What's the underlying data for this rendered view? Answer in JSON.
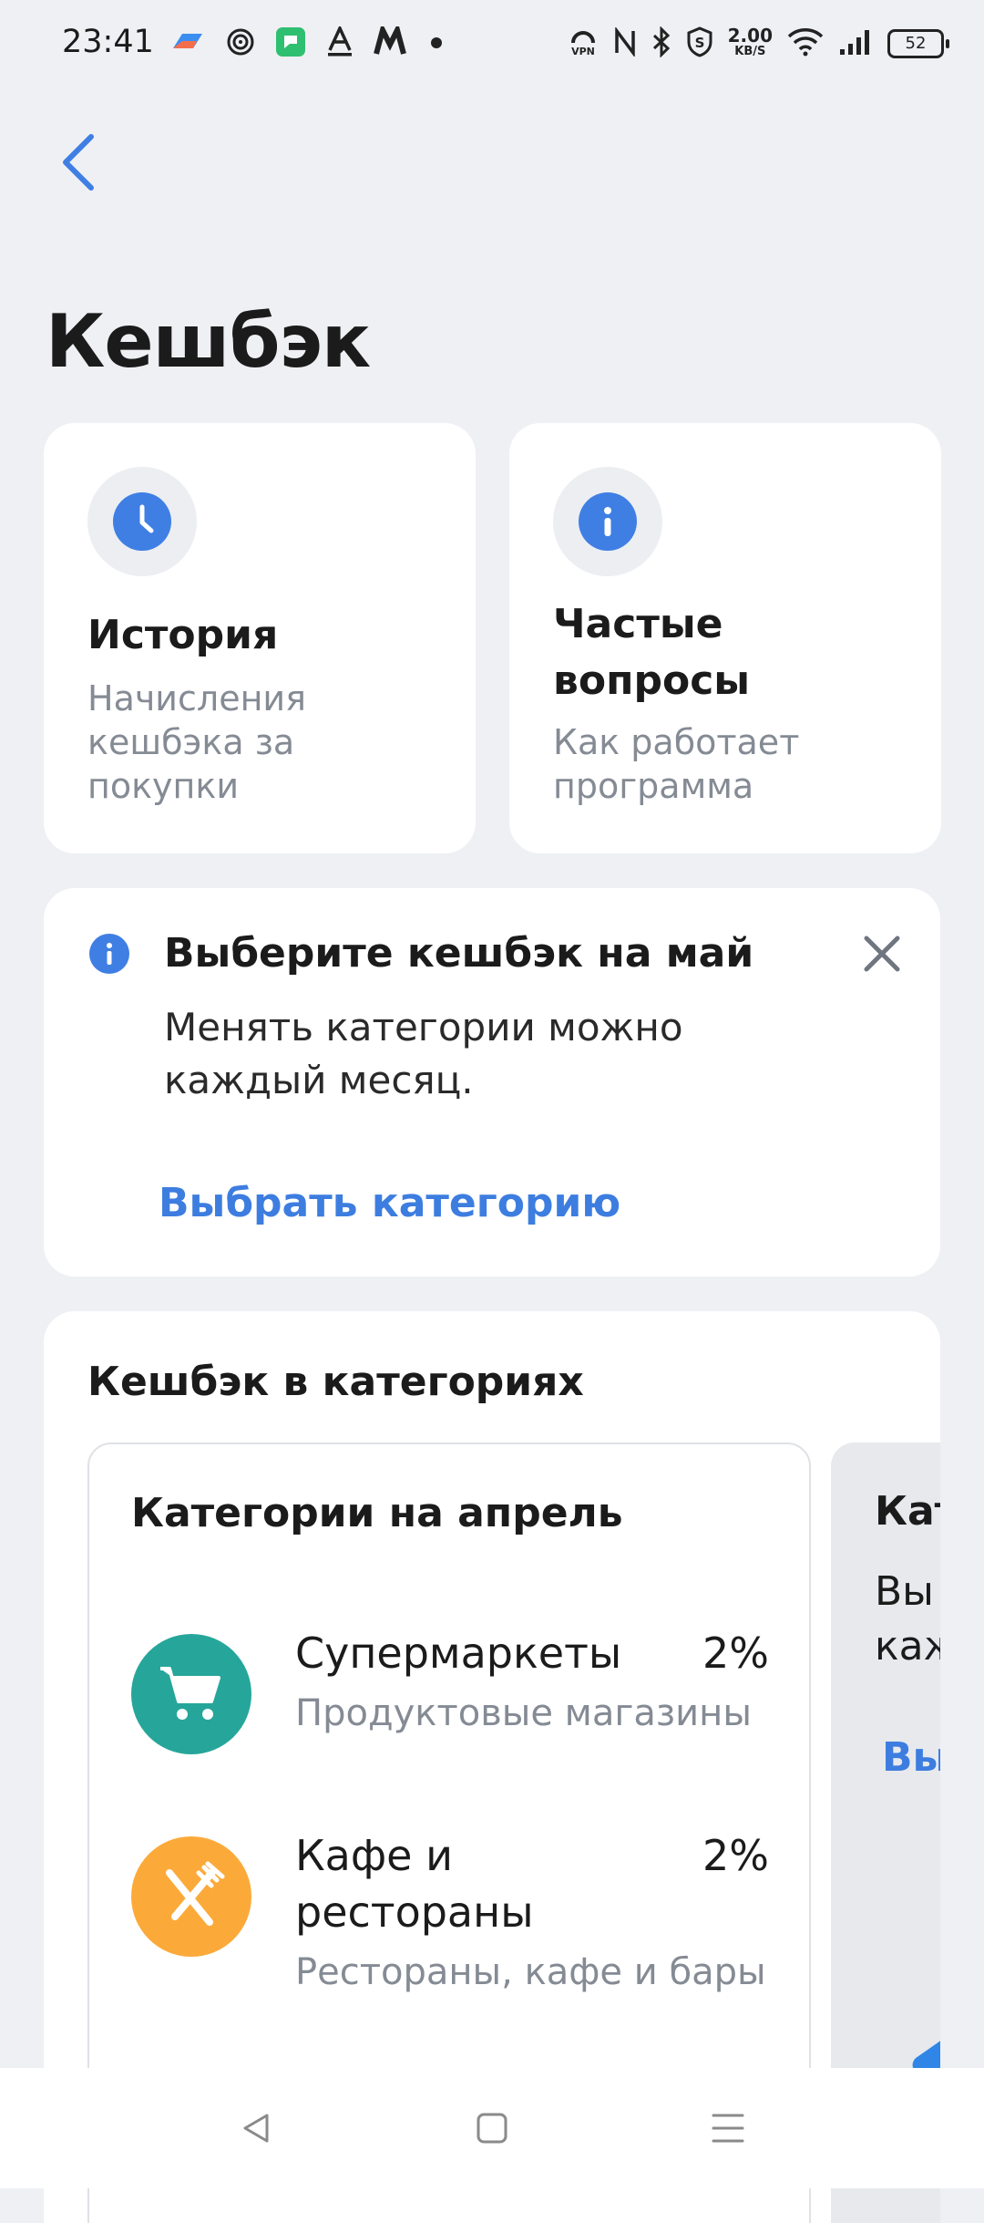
{
  "status_bar": {
    "time": "23:41",
    "speed_value": "2.00",
    "speed_unit": "KB/S",
    "battery": "52",
    "icons": [
      "app-icon",
      "target-icon",
      "chat-icon",
      "font-icon",
      "logo-icon",
      "dot-icon",
      "vpn-icon",
      "nfc-icon",
      "bluetooth-icon",
      "shield-icon",
      "wifi-icon",
      "signal-icon"
    ]
  },
  "header": {
    "title": "Кешбэк"
  },
  "tiles": {
    "history": {
      "title": "История",
      "subtitle": "Начисления кешбэка за покупки"
    },
    "faq": {
      "title": "Частые вопросы",
      "subtitle": "Как работает программа"
    }
  },
  "banner": {
    "title": "Выберите кешбэк на май",
    "text": "Менять категории можно каждый месяц.",
    "link": "Выбрать категорию"
  },
  "categories": {
    "title": "Кешбэк в категориях",
    "current": {
      "title": "Категории на апрель",
      "items": [
        {
          "name": "Супермаркеты",
          "percent": "2%",
          "description": "Продуктовые магазины"
        },
        {
          "name": "Кафе и рестораны",
          "percent": "2%",
          "description": "Рестораны, кафе и бары"
        }
      ]
    },
    "next": {
      "title": "Кат",
      "text": "Вы\nкаж",
      "link": "Вы"
    }
  },
  "colors": {
    "accent": "#3f7fe4",
    "link": "#3d7de0",
    "supermarket": "#26a69a",
    "cafe": "#fbaa3a",
    "background": "#eff0f4"
  }
}
